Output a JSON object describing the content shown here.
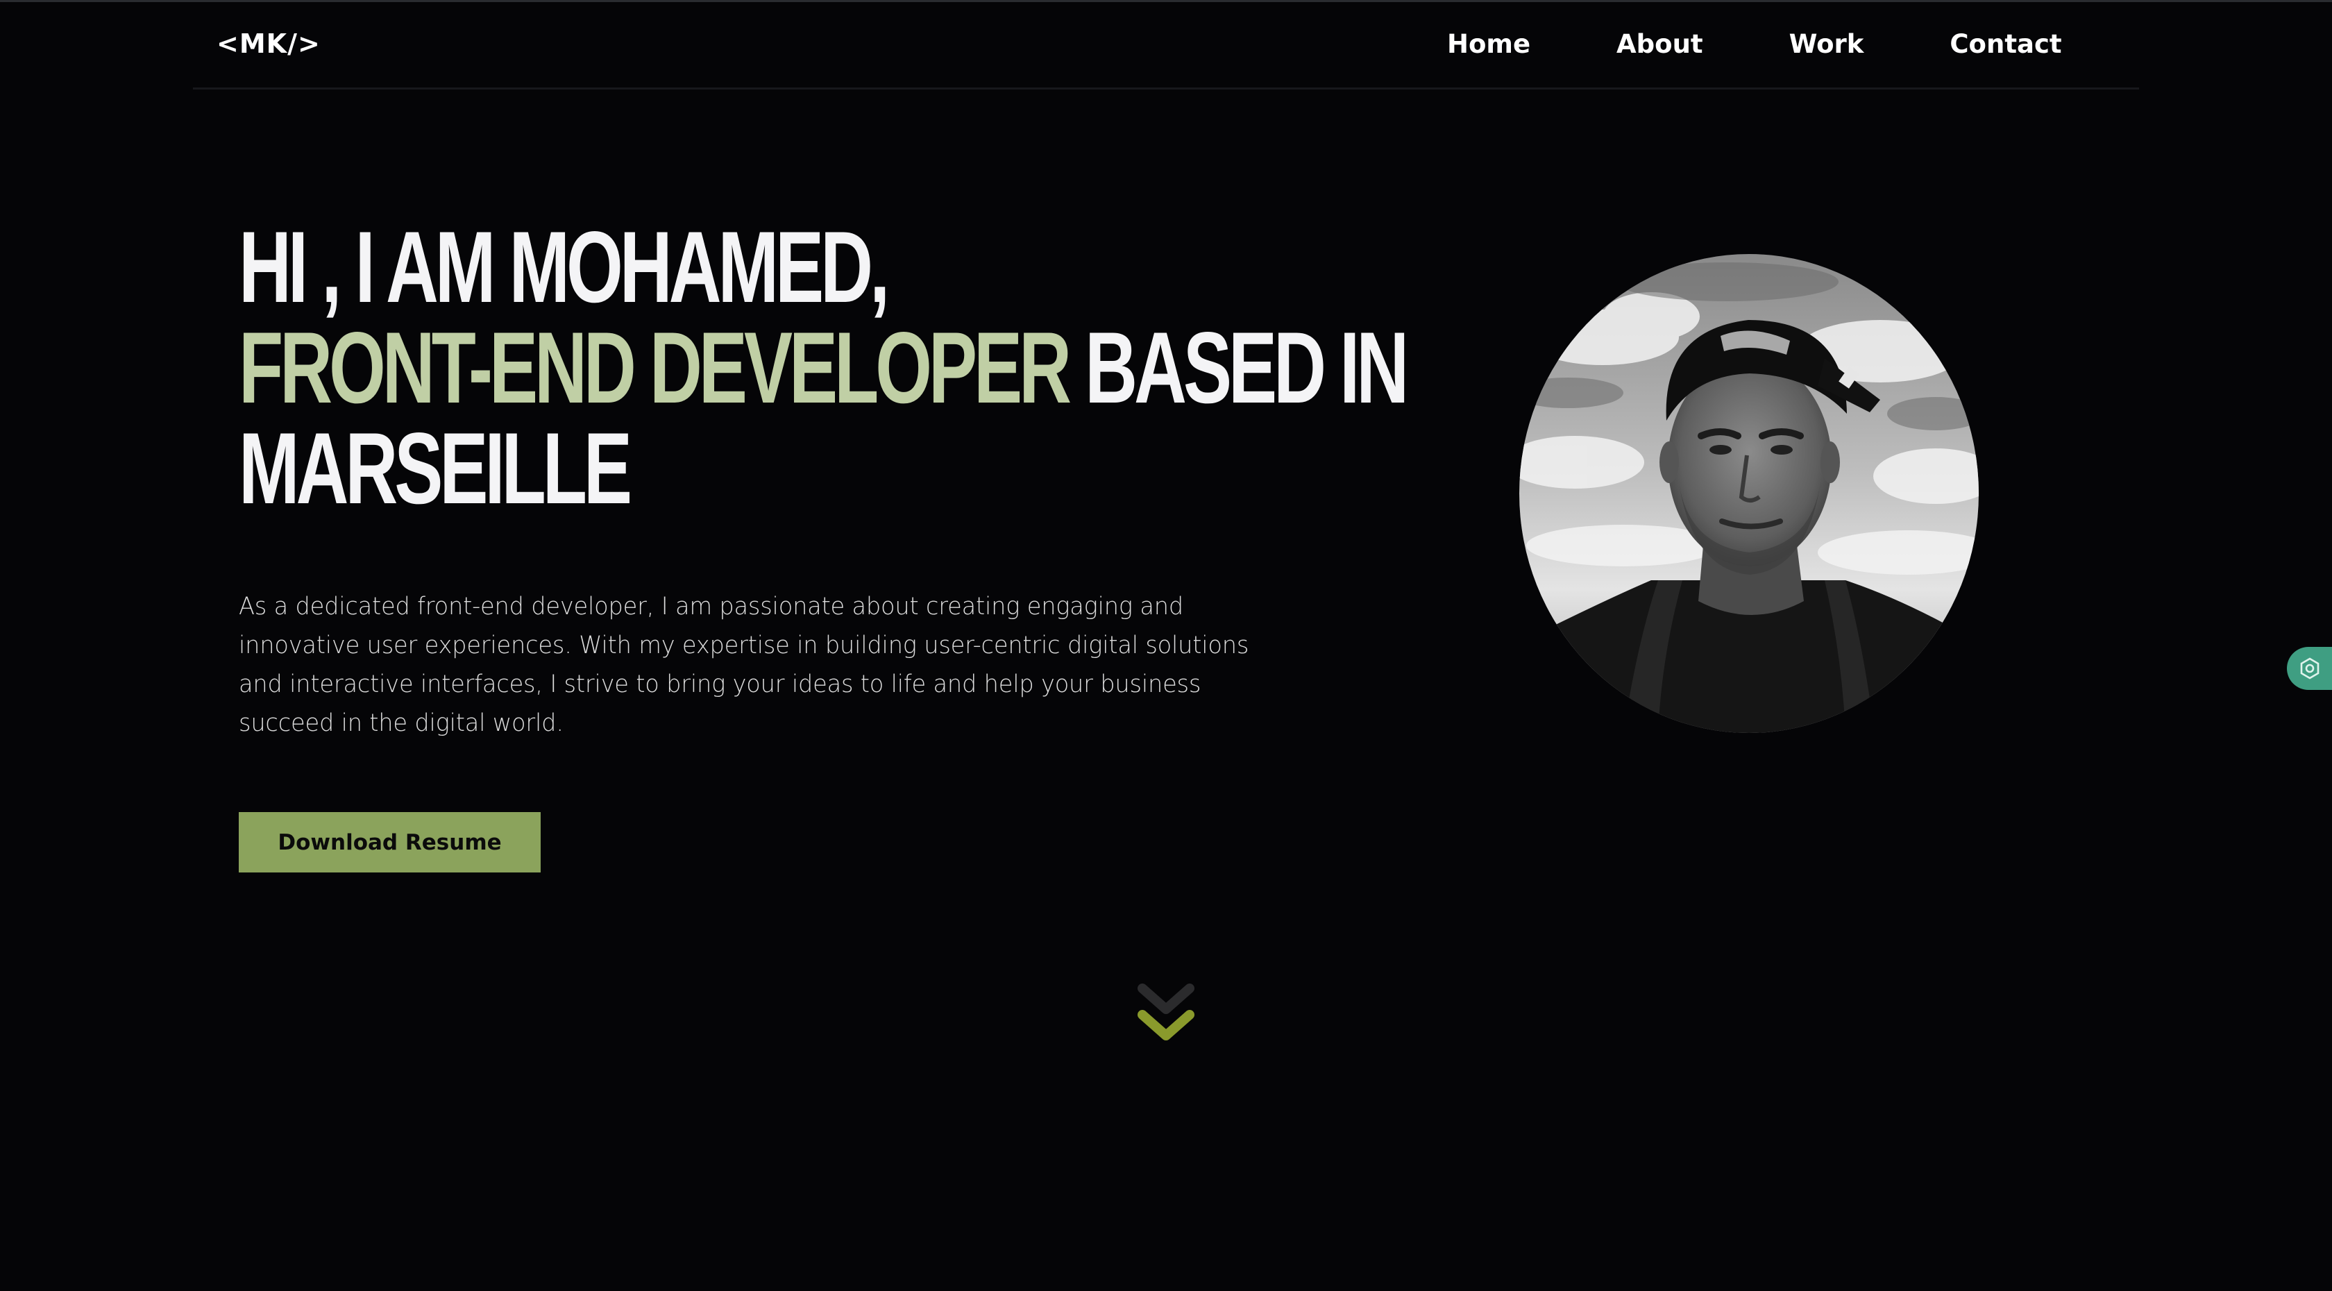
{
  "header": {
    "logo": "<MK/>",
    "nav": [
      {
        "label": "Home"
      },
      {
        "label": "About"
      },
      {
        "label": "Work"
      },
      {
        "label": "Contact"
      }
    ]
  },
  "hero": {
    "headline": {
      "line1": "HI , I AM MOHAMED,",
      "line2_accent": "FRONT-END DEVELOPER",
      "line2_rest": " BASED IN",
      "line3": "MARSEILLE"
    },
    "intro_lines": [
      "As a dedicated front-end developer, I am passionate about creating engaging and",
      "innovative user experiences. With my expertise in building user-centric digital solutions",
      "and interactive interfaces, I strive to bring your ideas to life and help your business",
      "succeed in the digital world."
    ],
    "cta_label": "Download Resume",
    "portrait_icon": "portrait-photo",
    "scroll_icon": "chevron-double-down-icon"
  },
  "side_widget_icon": "hexagon-settings-icon",
  "colors": {
    "background": "#050507",
    "accent_text": "#c0cfa5",
    "button": "#8ba35c",
    "chevron_primary": "#8a9a2c",
    "chevron_secondary": "#2b2b2d",
    "widget": "#3f9e82"
  }
}
